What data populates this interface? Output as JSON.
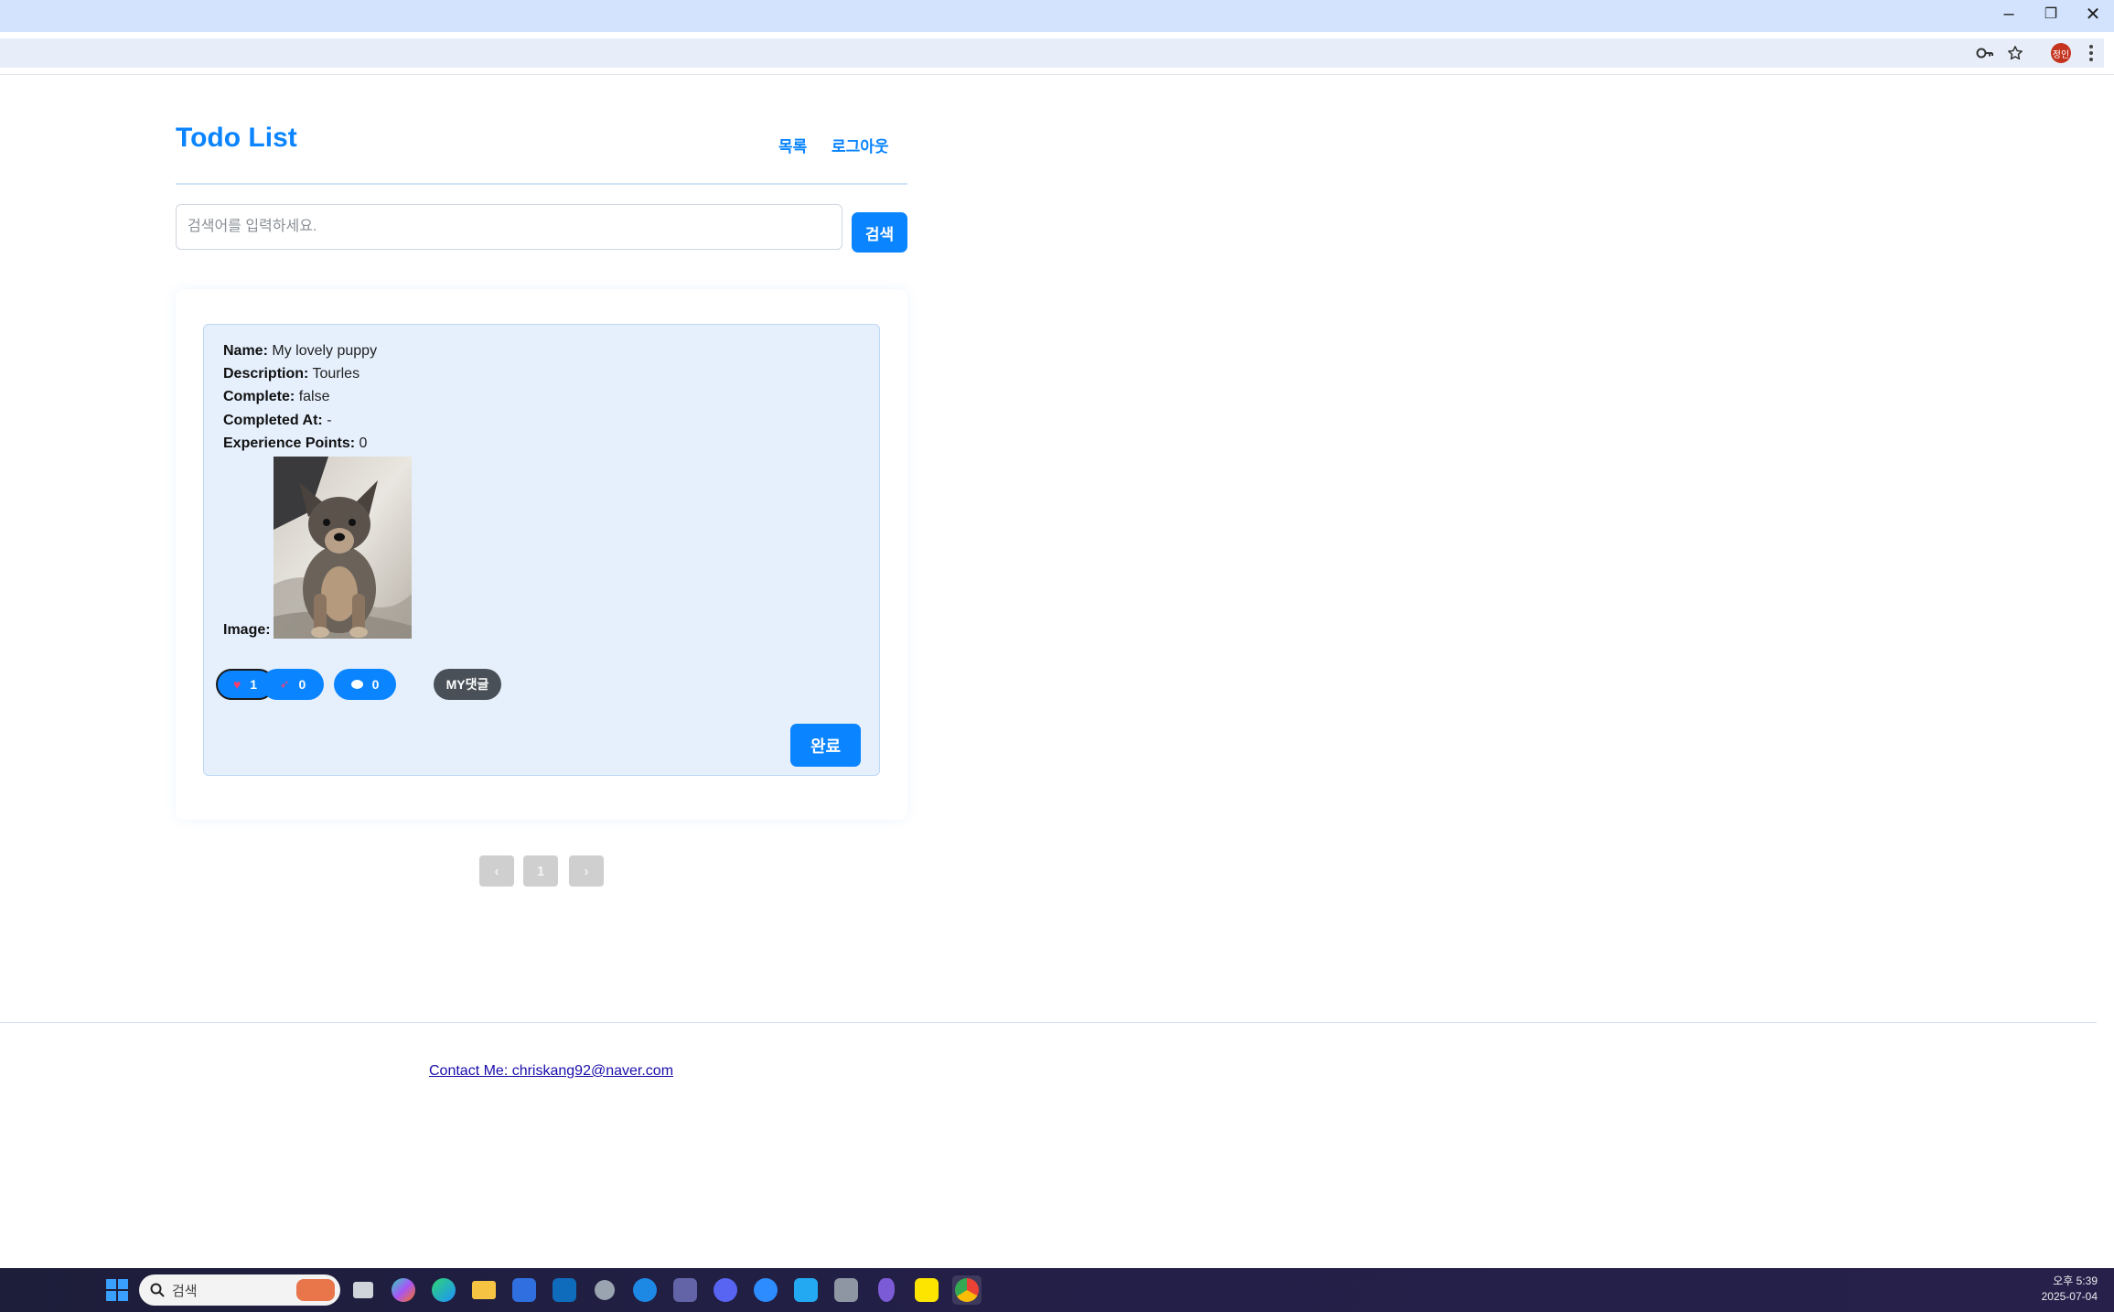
{
  "browser": {
    "window_controls": {
      "minimize": "–",
      "restore": "❐",
      "close": "✕"
    },
    "toolbar_icons": [
      "key-icon",
      "star-icon",
      "profile-avatar",
      "menu-icon"
    ],
    "profile_initials": "정인"
  },
  "header": {
    "brand": "Todo List",
    "nav": {
      "list": "목록",
      "logout": "로그아웃"
    }
  },
  "search": {
    "placeholder": "검색어를 입력하세요.",
    "button": "검색"
  },
  "todos": [
    {
      "fields": {
        "name_label": "Name:",
        "name": "My lovely puppy",
        "description_label": "Description:",
        "description": "Tourles",
        "complete_label": "Complete:",
        "complete": "false",
        "completed_at_label": "Completed At:",
        "completed_at": "-",
        "xp_label": "Experience Points:",
        "xp": "0",
        "image_label": "Image:"
      },
      "image_subject": "puppy photo",
      "reactions": {
        "like_icon": "heart-icon",
        "like": "1",
        "share_icon": "rocket-icon",
        "share": "0",
        "comment_icon": "speech-bubble-icon",
        "comment": "0",
        "my_comments": "MY댓글"
      },
      "complete_button": "완료"
    }
  ],
  "pagination": {
    "prev": "‹",
    "current": "1",
    "next": "›"
  },
  "footer": {
    "contact": "Contact Me: chriskang92@naver.com"
  },
  "taskbar": {
    "search_placeholder": "검색",
    "time": "오후 5:39",
    "date": "2025-07-04"
  },
  "colors": {
    "accent": "#0a84ff",
    "card_bg": "#e6f0fd",
    "dark_pill": "#495057"
  }
}
